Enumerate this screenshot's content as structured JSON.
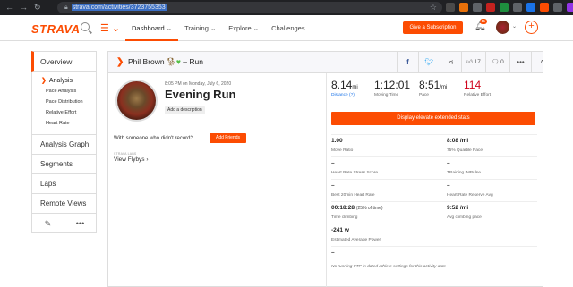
{
  "browser": {
    "url": "strava.com/activities/3723755353"
  },
  "header": {
    "logo": "STRAVA",
    "nav": [
      {
        "label": "Dashboard ⌄",
        "active": true
      },
      {
        "label": "Training ⌄",
        "active": false
      },
      {
        "label": "Explore ⌄",
        "active": false
      },
      {
        "label": "Challenges",
        "active": false
      }
    ],
    "subscribe_label": "Give a Subscription",
    "notification_count": "11"
  },
  "sidebar": {
    "overview": "Overview",
    "analysis": "Analysis",
    "analysis_sub": [
      "Pace Analysis",
      "Pace Distribution",
      "Relative Effort",
      "Heart Rate"
    ],
    "items": [
      "Analysis Graph",
      "Segments",
      "Laps",
      "Remote Views"
    ]
  },
  "activity": {
    "athlete_line": "Phil Brown",
    "title_suffix": "– Run",
    "kudos_count": "17",
    "comments_count": "0",
    "date": "8:05 PM on Monday, July 6, 2020",
    "name": "Evening Run",
    "add_description": "Add a description",
    "with_prompt": "With someone who didn't record?",
    "add_friends": "Add Friends",
    "flyby_small": "STRAVA LABS",
    "flyby": "View Flybys ›"
  },
  "stats": {
    "distance_value": "8.14",
    "distance_unit": "mi",
    "distance_label": "Distance (?)",
    "moving_time_value": "1:12:01",
    "moving_time_label": "Moving Time",
    "pace_value": "8:51",
    "pace_unit": "/mi",
    "pace_label": "Pace",
    "relative_effort_value": "114",
    "relative_effort_label": "Relative Effort",
    "elevate_label": "Display elevate extended stats",
    "grid": [
      {
        "lv": "1.00",
        "ll": "Move Ratio",
        "rv": "8:08 /mi",
        "rl": "75% Quartile Pace"
      },
      {
        "lv": "–",
        "ll": "Heart Rate Stress Score",
        "rv": "–",
        "rl": "TRaining IMPulse"
      },
      {
        "lv": "–",
        "ll": "Best 20min Heart Rate",
        "rv": "–",
        "rl": "Heart Rate Reserve Avg"
      },
      {
        "lv": "00:18:28",
        "lpct": "(25% of time)",
        "ll": "Time climbing",
        "rv": "9:52 /mi",
        "rl": "Avg climbing pace"
      },
      {
        "lv": "-241 w",
        "ll": "Estimated Average Power",
        "rv": "",
        "rl": ""
      }
    ],
    "note_dash": "–",
    "note": "No running FTP in dated athlete settings for this activity date"
  }
}
